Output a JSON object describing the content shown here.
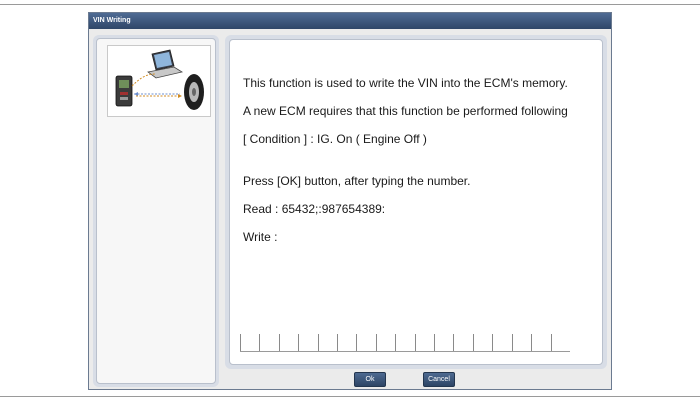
{
  "dialog": {
    "title": "VIN Writing"
  },
  "message": {
    "line1": "This function is used to write the VIN into the ECM's memory.",
    "line2": "A new ECM requires that this function be performed following",
    "line3": "[ Condition ] : IG. On ( Engine Off )",
    "line4": "Press [OK] button, after typing the number.",
    "read": "Read : 65432;:987654389:",
    "write": "Write :"
  },
  "vin_entry": {
    "value": "",
    "cell_count": 17
  },
  "buttons": {
    "ok": "Ok",
    "cancel": "Cancel"
  },
  "colors": {
    "titlebar": "#2f4668",
    "button": "#3c5578",
    "panel_frame": "#d8dde6"
  }
}
